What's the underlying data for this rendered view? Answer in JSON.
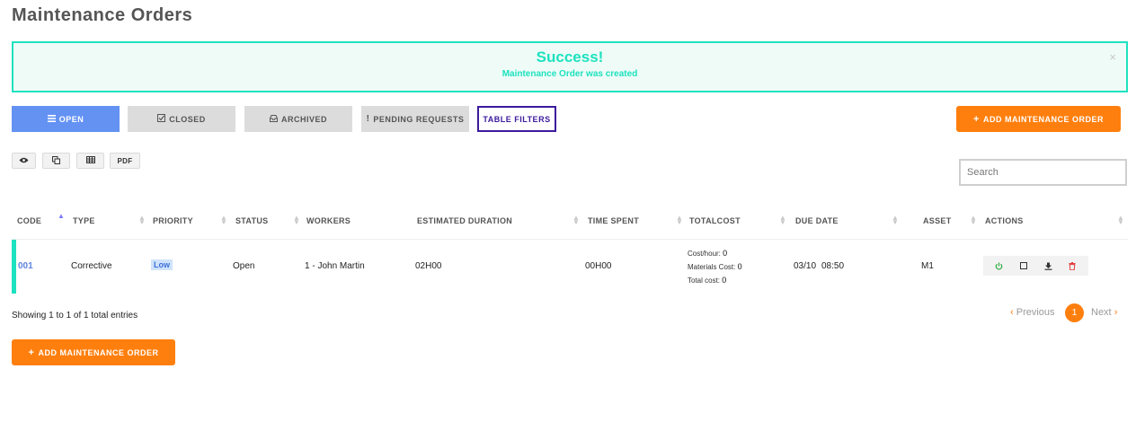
{
  "page": {
    "title": "Maintenance Orders"
  },
  "alert": {
    "title": "Success!",
    "message": "Maintenance Order was created",
    "close": "×"
  },
  "tabs": {
    "open": "OPEN",
    "closed": "CLOSED",
    "archived": "ARCHIVED",
    "pending": "PENDING REQUESTS",
    "filters": "TABLE FILTERS"
  },
  "add_button": {
    "label": "ADD MAINTENANCE ORDER"
  },
  "toolbar": {
    "pdf": "PDF"
  },
  "search": {
    "placeholder": "Search",
    "value": ""
  },
  "table": {
    "headers": [
      "CODE",
      "TYPE",
      "PRIORITY",
      "STATUS",
      "WORKERS",
      "ESTIMATED DURATION",
      "TIME SPENT",
      "TOTALCOST",
      "DUE DATE",
      "ASSET",
      "ACTIONS"
    ],
    "row": {
      "code": "001",
      "type": "Corrective",
      "priority": "Low",
      "status": "Open",
      "workers": "1 - John Martin",
      "estimated_duration": "02H00",
      "time_spent": "00H00",
      "cost_hour_label": "Cost/hour:",
      "cost_hour": "0",
      "materials_cost_label": "Materials Cost:",
      "materials_cost": "0",
      "total_cost_label": "Total cost:",
      "total_cost": "0",
      "due_date": "03/10",
      "due_time": "08:50",
      "asset": "M1"
    }
  },
  "footer": {
    "showing": "Showing 1 to 1 of 1 total entries"
  },
  "pagination": {
    "previous": "Previous",
    "page": "1",
    "next": "Next"
  },
  "colors": {
    "accent_orange": "#ff7f0e",
    "success_teal": "#1de2bf",
    "open_tab_blue": "#6492f3",
    "filters_purple": "#3c1a9c"
  }
}
